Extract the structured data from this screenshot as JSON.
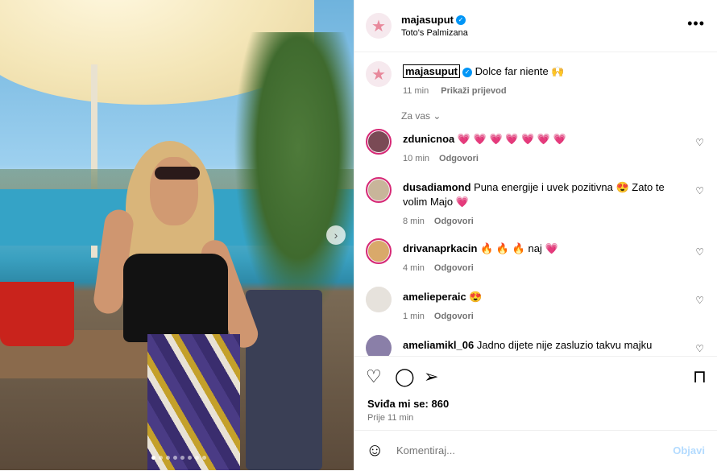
{
  "post": {
    "author": "majasuput",
    "location": "Toto's Palmizana",
    "caption_text": "Dolce far niente 🙌",
    "caption_time": "11 min",
    "translate_label": "Prikaži prijevod",
    "for_you_label": "Za vas",
    "likes_text": "Sviđa mi se: 860",
    "posted_ago": "Prije 11 min"
  },
  "comments": [
    {
      "user": "zdunicnoa",
      "text": "💗 💗 💗 💗 💗 💗 💗",
      "time": "10 min",
      "reply": "Odgovori"
    },
    {
      "user": "dusadiamond",
      "text": "Puna energije i uvek pozitivna 😍 Zato te volim Majo 💗",
      "time": "8 min",
      "reply": "Odgovori"
    },
    {
      "user": "drivanaprkacin",
      "text": "🔥 🔥 🔥 naj 💗",
      "time": "4 min",
      "reply": "Odgovori"
    },
    {
      "user": "amelieperaic",
      "text": "😍",
      "time": "1 min",
      "reply": "Odgovori"
    },
    {
      "user": "ameliamikl_06",
      "text": "Jadno dijete nije zasluzio takvu majku",
      "time": "",
      "reply": ""
    }
  ],
  "composer": {
    "placeholder": "Komentiraj...",
    "post_label": "Objavi"
  },
  "icons": {
    "more": "more-options-icon",
    "like": "heart-icon",
    "comment": "comment-icon",
    "share": "share-icon",
    "save": "bookmark-icon",
    "emoji": "emoji-icon",
    "verified": "verified-badge-icon"
  },
  "colors": {
    "verified": "#0095f6",
    "heart": "#e0245e",
    "story_ring": "#d62976",
    "muted_text": "#737373",
    "post_disabled": "#b3dbff"
  }
}
